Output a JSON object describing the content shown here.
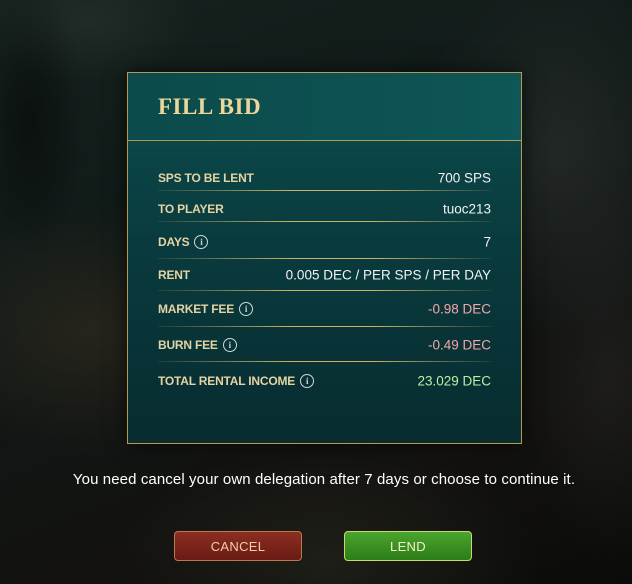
{
  "dialog": {
    "title": "FILL BID",
    "rows": [
      {
        "label": "SPS TO BE LENT",
        "value": "700 SPS",
        "info": false
      },
      {
        "label": "TO PLAYER",
        "value": "tuoc213",
        "info": false
      },
      {
        "label": "DAYS",
        "value": "7",
        "info": true
      },
      {
        "label": "RENT",
        "value": "0.005 DEC / PER SPS / PER DAY",
        "info": false
      },
      {
        "label": "MARKET FEE",
        "value": "-0.98 DEC",
        "info": true
      },
      {
        "label": "BURN FEE",
        "value": "-0.49 DEC",
        "info": true
      },
      {
        "label": "TOTAL RENTAL INCOME",
        "value": "23.029 DEC",
        "info": true
      }
    ],
    "info_glyph": "i"
  },
  "notice": "You need cancel your own delegation after 7 days or choose to continue it.",
  "buttons": {
    "cancel_label": "CANCEL",
    "lend_label": "LEND"
  },
  "colors": {
    "accent_gold": "#c9a85a",
    "negative": "#f5a7a7",
    "positive": "#b9f0a2",
    "cancel_bg": "#7a241a",
    "lend_bg": "#3a9222"
  },
  "icons": {
    "info": "info-icon"
  }
}
